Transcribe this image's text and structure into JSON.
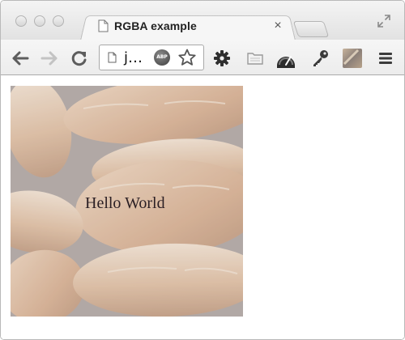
{
  "browser": {
    "tab": {
      "title": "RGBA example",
      "close_glyph": "×"
    },
    "toolbar": {
      "address_text": "j…",
      "extension_badge": "ABP"
    }
  },
  "page": {
    "heading": "Hello World"
  },
  "icons": {
    "back": "back-arrow-icon",
    "forward": "forward-arrow-icon",
    "reload": "reload-icon",
    "page": "page-icon",
    "bookmark": "star-icon",
    "settings": "gear-icon",
    "folder": "folder-icon",
    "speedometer": "speedometer-icon",
    "key": "key-icon",
    "menu": "hamburger-menu-icon"
  },
  "colors": {
    "text": "#2b1f24",
    "photo_tint": "#ada49f"
  }
}
